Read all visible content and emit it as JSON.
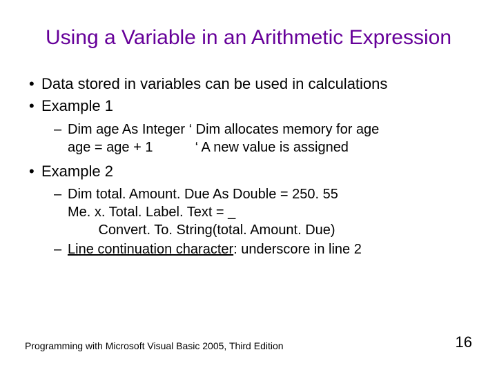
{
  "title": "Using a Variable in an Arithmetic Expression",
  "bullets": {
    "b1": "Data stored in variables can be used in calculations",
    "b2": "Example 1",
    "b2_sub1_line1": "Dim age As Integer ‘ Dim allocates memory for age",
    "b2_sub1_line2": "age = age + 1           ‘ A new value is assigned",
    "b3": "Example 2",
    "b3_sub1_line1": "Dim total. Amount. Due As Double = 250. 55",
    "b3_sub1_line2": "Me. x. Total. Label. Text = _",
    "b3_sub1_line3": "        Convert. To. String(total. Amount. Due)",
    "b3_sub2_prefix": "Line continuation character",
    "b3_sub2_suffix": ": underscore in line 2"
  },
  "footer": {
    "left": "Programming with Microsoft Visual Basic 2005, Third Edition",
    "pageNumber": "16"
  }
}
